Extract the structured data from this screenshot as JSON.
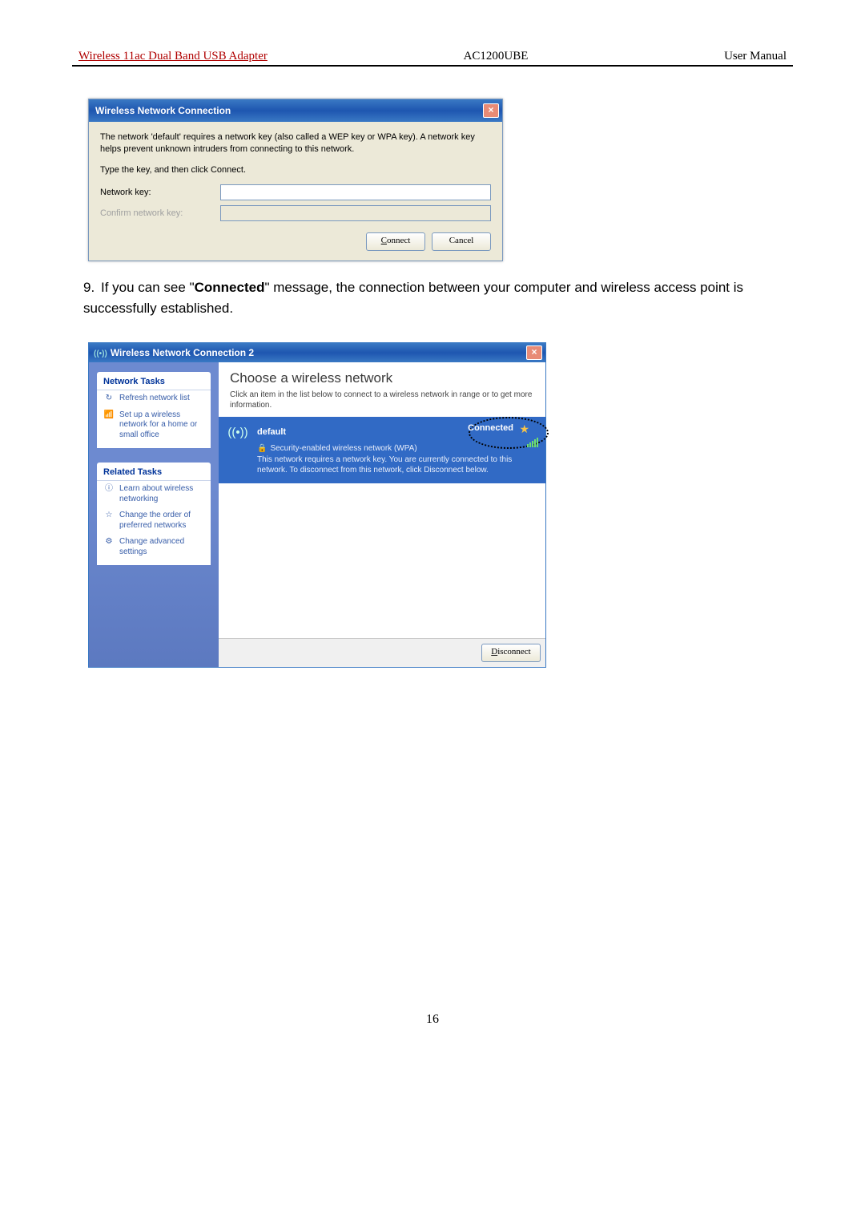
{
  "header": {
    "left": "Wireless 11ac Dual Band USB Adapter",
    "mid": "AC1200UBE",
    "right": "User Manual"
  },
  "dlg1": {
    "title": "Wireless Network Connection",
    "p1": "The network 'default' requires a network key (also called a WEP key or WPA key). A network key helps prevent unknown intruders from connecting to this network.",
    "p2": "Type the key, and then click Connect.",
    "labelKey": "Network key:",
    "labelConfirm": "Confirm network key:",
    "btnConnect": "Connect",
    "btnCancel": "Cancel"
  },
  "step": {
    "num": "9.",
    "pre": "If you can see \"",
    "bold": "Connected",
    "post": "\" message, the connection between your computer and wireless access point is successfully established."
  },
  "dlg2": {
    "title": "Wireless Network Connection 2",
    "side": {
      "g1": "Network Tasks",
      "l1": "Refresh network list",
      "l2": "Set up a wireless network for a home or small office",
      "g2": "Related Tasks",
      "l3": "Learn about wireless networking",
      "l4": "Change the order of preferred networks",
      "l5": "Change advanced settings"
    },
    "content": {
      "heading": "Choose a wireless network",
      "sub": "Click an item in the list below to connect to a wireless network in range or to get more information.",
      "net": {
        "name": "default",
        "status": "Connected",
        "sec": "Security-enabled wireless network (WPA)",
        "desc": "This network requires a network key. You are currently connected to this network. To disconnect from this network, click Disconnect below."
      },
      "btn": "Disconnect"
    }
  },
  "pageNum": "16"
}
